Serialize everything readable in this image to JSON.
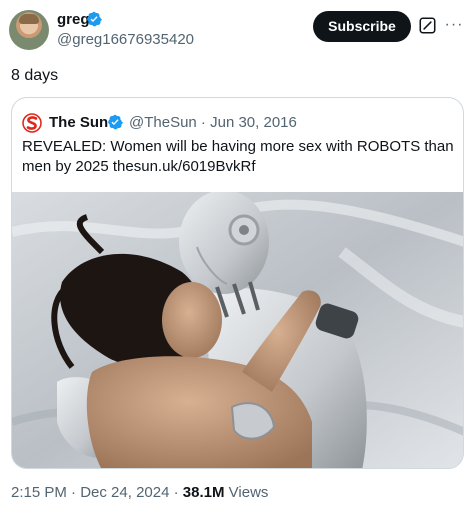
{
  "author": {
    "display_name": "greg",
    "handle": "@greg16676935420",
    "verified_icon": "verified-badge-icon",
    "avatar_icon": "avatar"
  },
  "actions": {
    "subscribe_label": "Subscribe",
    "grok_icon": "grok-icon",
    "more_icon": "more-options-icon",
    "more_glyph": "···"
  },
  "tweet": {
    "text": "8 days"
  },
  "quote": {
    "author_name": "The Sun",
    "handle": "@TheSun",
    "separator": " · ",
    "date": "Jun 30, 2016",
    "text": "REVEALED: Women will be having more sex with ROBOTS than men by 2025 thesun.uk/6019BvkRf",
    "logo_icon": "the-sun-logo-icon",
    "verified_icon": "verified-badge-icon",
    "media_icon": "quote-media-image"
  },
  "footer": {
    "time": "2:15 PM",
    "separator": " · ",
    "date": "Dec 24, 2024",
    "views_count": "38.1M",
    "views_label": " Views"
  },
  "colors": {
    "primary_text": "#0f1419",
    "secondary_text": "#536471",
    "verified_blue": "#1d9bf0",
    "border": "#cfd9de",
    "sun_red": "#e1261c"
  }
}
